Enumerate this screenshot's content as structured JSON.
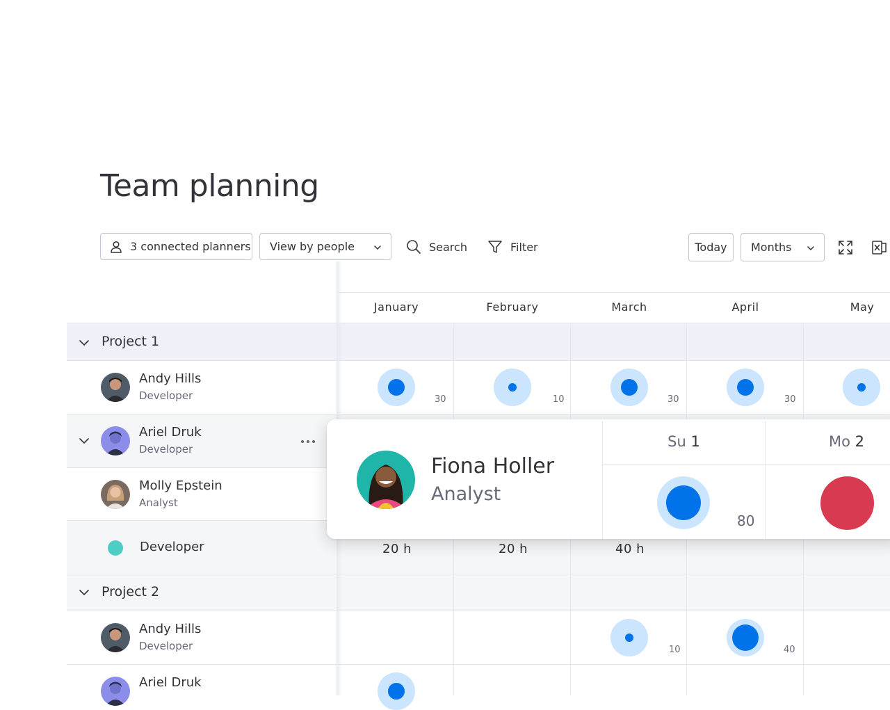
{
  "page_title": "Team planning",
  "toolbar": {
    "connected_planners": "3 connected planners",
    "view_by": "View by people",
    "search": "Search",
    "filter": "Filter",
    "today": "Today",
    "period": "Months"
  },
  "months": [
    "January",
    "February",
    "March",
    "April",
    "May"
  ],
  "groups": [
    {
      "label": "Project 1",
      "people": [
        {
          "name": "Andy Hills",
          "role": "Developer",
          "allocations": [
            "30",
            "10",
            "30",
            "30",
            ""
          ]
        },
        {
          "name": "Ariel Druk",
          "role": "Developer"
        },
        {
          "name": "Molly Epstein",
          "role": "Analyst"
        }
      ],
      "role_summary": {
        "label": "Developer",
        "hours": [
          "20 h",
          "20 h",
          "40 h"
        ]
      }
    },
    {
      "label": "Project 2",
      "people": [
        {
          "name": "Andy Hills",
          "role": "Developer",
          "allocations": [
            "10",
            "40"
          ]
        },
        {
          "name": "Ariel Druk",
          "role": "Developer"
        }
      ]
    }
  ],
  "popup": {
    "name": "Fiona Holler",
    "role": "Analyst",
    "days": [
      {
        "weekday": "Su",
        "day": "1",
        "value": "80"
      },
      {
        "weekday": "Mo",
        "day": "2"
      }
    ]
  },
  "colors": {
    "accent": "#0073ea",
    "bubble": "#cce5ff",
    "developer_role": "#4ecdc4",
    "over_capacity": "#d83a52",
    "group_header_bg": "#eef1f8"
  },
  "icons": [
    "person-icon",
    "chevron-down-icon",
    "search-icon",
    "filter-icon",
    "expand-icon",
    "excel-icon",
    "more-icon"
  ]
}
